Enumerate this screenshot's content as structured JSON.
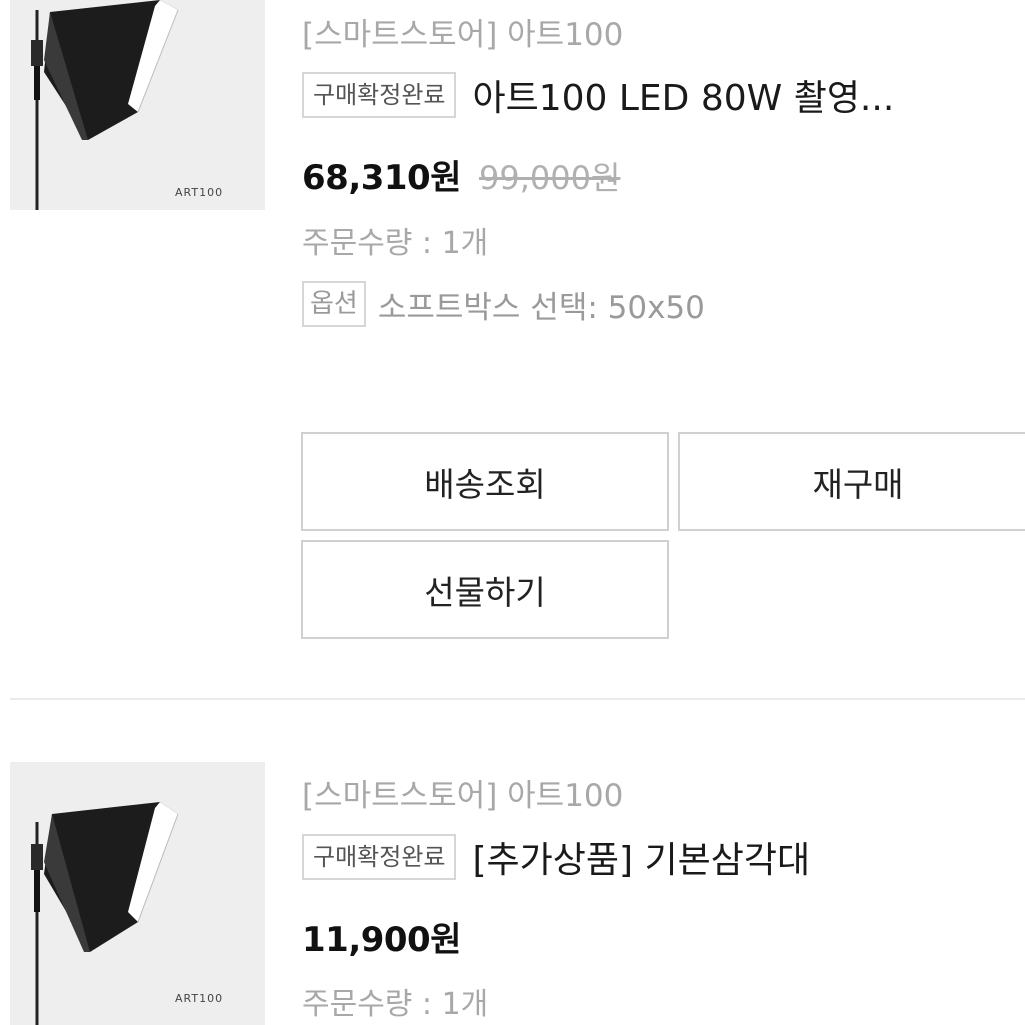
{
  "orders": [
    {
      "store": "[스마트스토어] 아트100",
      "status": "구매확정완료",
      "product_name": "아트100 LED 80W 촬영...",
      "price": "68,310원",
      "original_price": "99,000원",
      "quantity": "주문수량 : 1개",
      "option_label": "옵션",
      "option_value": "소프트박스 선택: 50x50",
      "thumbnail_text": "ART100",
      "buttons": {
        "track_delivery": "배송조회",
        "rebuy": "재구매",
        "gift": "선물하기"
      }
    },
    {
      "store": "[스마트스토어] 아트100",
      "status": "구매확정완료",
      "product_name": "[추가상품] 기본삼각대",
      "price": "11,900원",
      "quantity": "주문수량 : 1개",
      "thumbnail_text": "ART100"
    }
  ],
  "colors": {
    "muted_text": "#a8a8a8",
    "border": "#d0d0d0",
    "thumbnail_bg": "#eeeeee"
  }
}
